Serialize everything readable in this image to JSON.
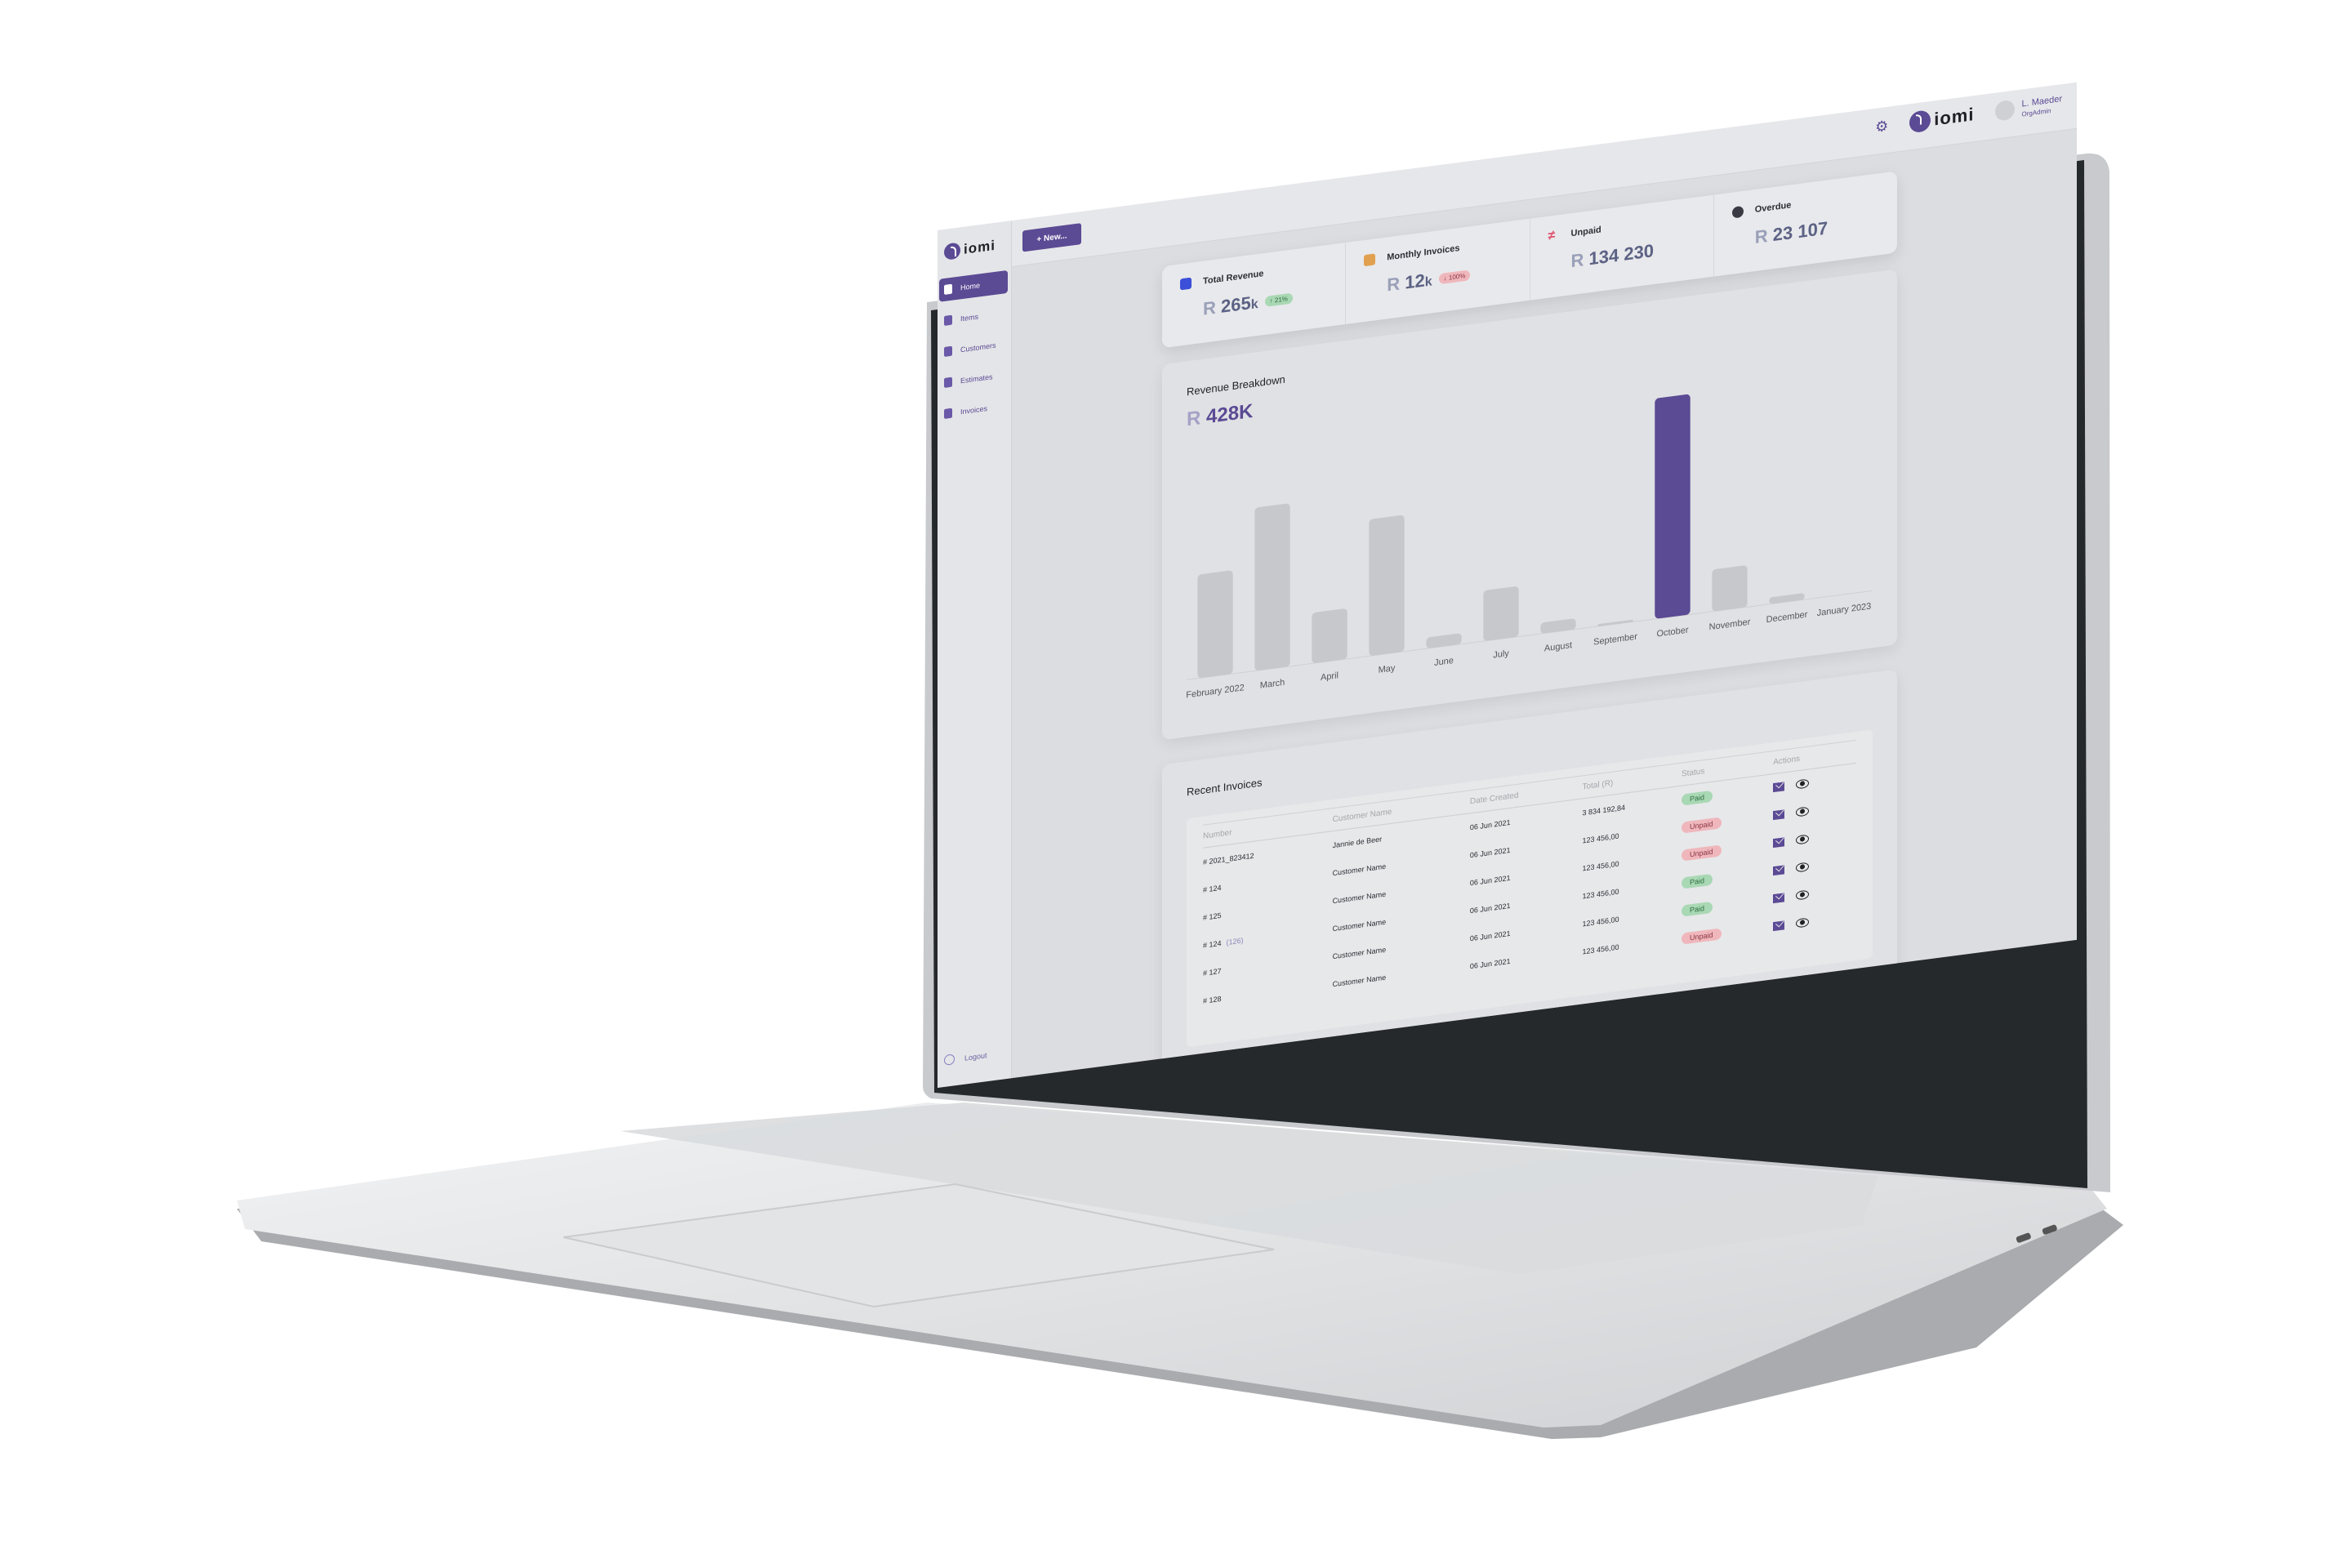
{
  "app": {
    "brand": "iomi",
    "new_button": "+ New...",
    "user": {
      "name": "L. Maeder",
      "role": "OrgAdmin"
    }
  },
  "sidebar": {
    "items": [
      {
        "label": "Home",
        "icon": "home-icon",
        "active": true
      },
      {
        "label": "Items",
        "icon": "list-icon",
        "active": false
      },
      {
        "label": "Customers",
        "icon": "customer-icon",
        "active": false
      },
      {
        "label": "Estimates",
        "icon": "estimate-icon",
        "active": false
      },
      {
        "label": "Invoices",
        "icon": "invoice-icon",
        "active": false
      }
    ],
    "logout": "Logout"
  },
  "stats": [
    {
      "label": "Total Revenue",
      "currency": "R",
      "value": "265",
      "suffix": "k",
      "change": "↑ 21%",
      "trend": "up",
      "icon": "money-icon",
      "icon_color": "#3b4fd8"
    },
    {
      "label": "Monthly Invoices",
      "currency": "R",
      "value": "12",
      "suffix": "k",
      "change": "↓ 100%",
      "trend": "down",
      "icon": "document-icon",
      "icon_color": "#e0a050"
    },
    {
      "label": "Unpaid",
      "currency": "R",
      "value": "134 230",
      "suffix": "",
      "change": "",
      "trend": "",
      "icon": "not-equal-icon",
      "icon_color": "#e0506a"
    },
    {
      "label": "Overdue",
      "currency": "R",
      "value": "23 107",
      "suffix": "",
      "change": "",
      "trend": "",
      "icon": "lifebuoy-icon",
      "icon_color": "#3a3a44"
    }
  ],
  "revenue": {
    "title": "Revenue Breakdown",
    "currency": "R",
    "total": "428K"
  },
  "chart_data": {
    "type": "bar",
    "title": "Revenue Breakdown",
    "xlabel": "",
    "ylabel": "",
    "grid": false,
    "highlight_index": 8,
    "highlight_color": "#5b4a94",
    "base_color": "#c6c8cc",
    "categories": [
      "February 2022",
      "March",
      "April",
      "May",
      "June",
      "July",
      "August",
      "September",
      "October",
      "November",
      "December",
      "January 2023"
    ],
    "values": [
      47,
      74,
      23,
      62,
      5,
      23,
      5,
      1,
      100,
      19,
      3,
      0
    ],
    "ylim": [
      0,
      100
    ]
  },
  "invoices": {
    "title": "Recent Invoices",
    "columns": [
      "Number",
      "Customer Name",
      "Date Created",
      "Total (R)",
      "Status",
      "Actions"
    ],
    "rows": [
      {
        "number": "# 2021_823412",
        "sub": "",
        "customer": "Jannie de Beer",
        "date": "06 Jun 2021",
        "total": "3 834 192,84",
        "status": "Paid"
      },
      {
        "number": "# 124",
        "sub": "",
        "customer": "Customer Name",
        "date": "06 Jun 2021",
        "total": "123 456,00",
        "status": "Unpaid"
      },
      {
        "number": "# 125",
        "sub": "",
        "customer": "Customer Name",
        "date": "06 Jun 2021",
        "total": "123 456,00",
        "status": "Unpaid"
      },
      {
        "number": "# 124",
        "sub": "(126)",
        "customer": "Customer Name",
        "date": "06 Jun 2021",
        "total": "123 456,00",
        "status": "Paid"
      },
      {
        "number": "# 127",
        "sub": "",
        "customer": "Customer Name",
        "date": "06 Jun 2021",
        "total": "123 456,00",
        "status": "Paid"
      },
      {
        "number": "# 128",
        "sub": "",
        "customer": "Customer Name",
        "date": "06 Jun 2021",
        "total": "123 456,00",
        "status": "Unpaid"
      }
    ]
  }
}
